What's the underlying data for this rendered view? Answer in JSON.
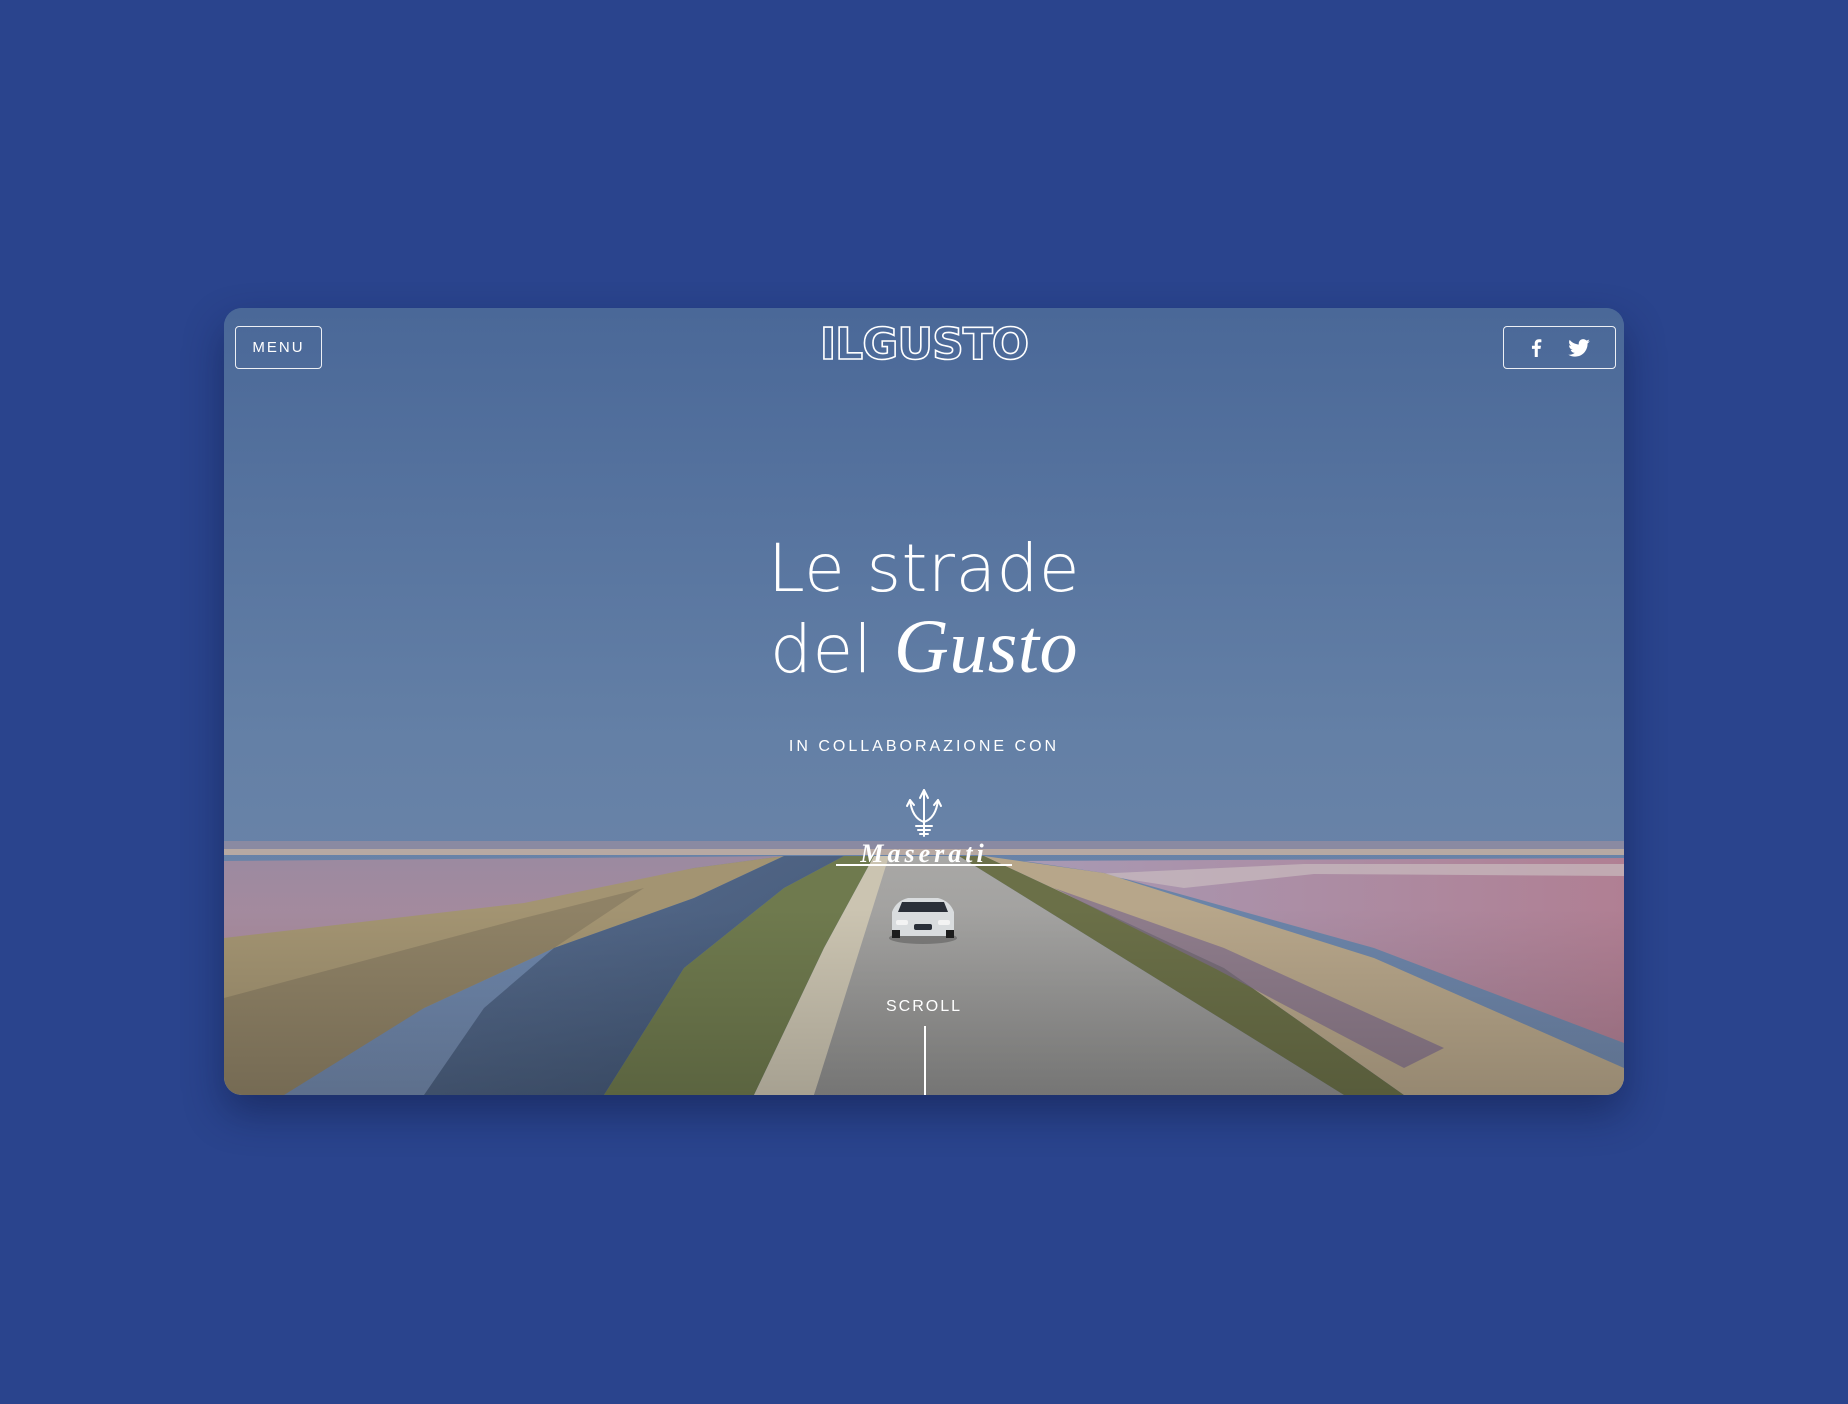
{
  "header": {
    "menu_label": "MENU",
    "logo_text": "ILGUSTO",
    "social": [
      {
        "icon": "facebook-icon",
        "label": "Facebook"
      },
      {
        "icon": "twitter-icon",
        "label": "Twitter"
      }
    ]
  },
  "hero": {
    "title_line1": "Le strade",
    "title_line2_plain": "del",
    "title_line2_italic": "Gusto",
    "collab_label": "IN COLLABORAZIONE CON",
    "partner_logo_text": "Maserati",
    "scroll_label": "SCROLL"
  },
  "colors": {
    "page_background": "#2a448d",
    "text": "#ffffff"
  }
}
